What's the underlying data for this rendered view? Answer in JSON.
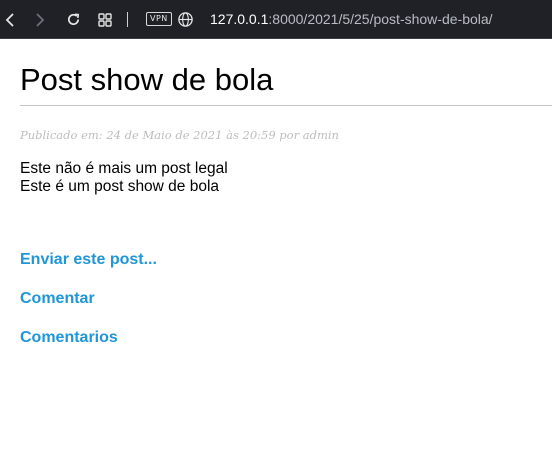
{
  "browser": {
    "url_host": "127.0.0.1",
    "url_path": ":8000/2021/5/25/post-show-de-bola/",
    "vpn_label": "VPN",
    "icons": [
      "back-icon",
      "forward-icon",
      "reload-icon",
      "tabs-grid-icon",
      "vpn-badge",
      "globe-icon"
    ]
  },
  "post": {
    "title": "Post show de bola",
    "meta": "Publicado em: 24 de Maio de 2021 às 20:59 por admin",
    "body_lines": [
      "Este não é mais um post legal",
      "Este é um post show de bola"
    ]
  },
  "actions": {
    "share": "Enviar este post...",
    "comment": "Comentar",
    "comments": "Comentarios"
  },
  "colors": {
    "toolbar_bg": "#1f2127",
    "link": "#2196d6",
    "meta_text": "#bdbdbd"
  }
}
